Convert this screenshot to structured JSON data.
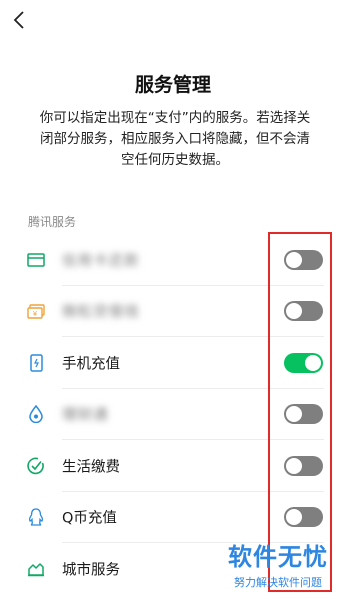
{
  "header": {
    "back_icon": "chevron-left-icon"
  },
  "title": "服务管理",
  "description": "你可以指定出现在“支付”内的服务。若选择关闭部分服务，相应服务入口将隐藏，但不会清空任何历史数据。",
  "section_label": "腾讯服务",
  "colors": {
    "accent": "#07c160",
    "toggle_off": "#7f7f7f",
    "highlight": "#e02b2b",
    "watermark": "#2e86e0"
  },
  "services": [
    {
      "label": "信用卡还款",
      "icon": "card-icon",
      "blurred": true,
      "enabled": false
    },
    {
      "label": "微粒贷借钱",
      "icon": "cash-icon",
      "blurred": true,
      "enabled": false
    },
    {
      "label": "手机充值",
      "icon": "phone-icon",
      "blurred": false,
      "enabled": true
    },
    {
      "label": "理财通",
      "icon": "drop-icon",
      "blurred": true,
      "enabled": false
    },
    {
      "label": "生活缴费",
      "icon": "check-circle-icon",
      "blurred": false,
      "enabled": false
    },
    {
      "label": "Q币充值",
      "icon": "penguin-icon",
      "blurred": false,
      "enabled": false
    },
    {
      "label": "城市服务",
      "icon": "city-icon",
      "blurred": false,
      "enabled": false
    }
  ],
  "watermark": {
    "title": "软件无忧",
    "subtitle": "努力解决软件问题"
  }
}
